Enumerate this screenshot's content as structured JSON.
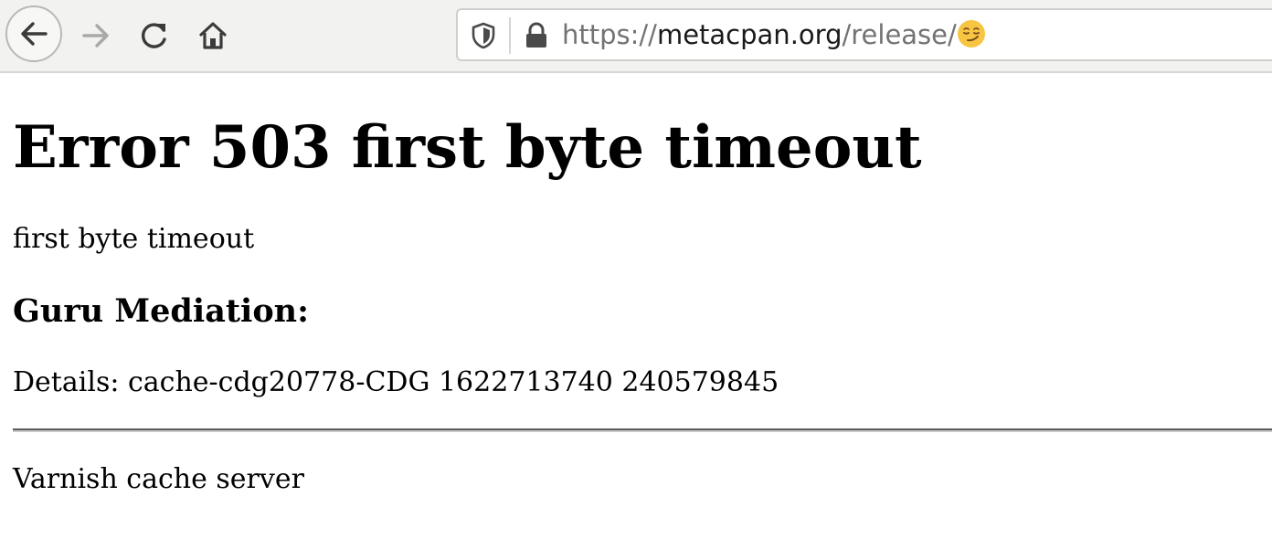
{
  "browser": {
    "url": {
      "scheme": "https://",
      "host": "metacpan.org",
      "path": "/release/",
      "emoji": "😏"
    },
    "icons": {
      "back": "arrow-left-icon",
      "forward": "arrow-right-icon",
      "reload": "reload-icon",
      "home": "home-icon",
      "tracking": "shield-icon",
      "security": "lock-icon"
    }
  },
  "page": {
    "heading": "Error 503 first byte timeout",
    "message": "first byte timeout",
    "guru_heading": "Guru Mediation:",
    "details": "Details: cache-cdg20778-CDG 1622713740 240579845",
    "footer": "Varnish cache server"
  },
  "colors": {
    "toolbar_bg": "#f2f2f1",
    "url_host": "#1a1a1a",
    "url_muted": "#737373",
    "emoji_yellow": "#f7c541"
  }
}
